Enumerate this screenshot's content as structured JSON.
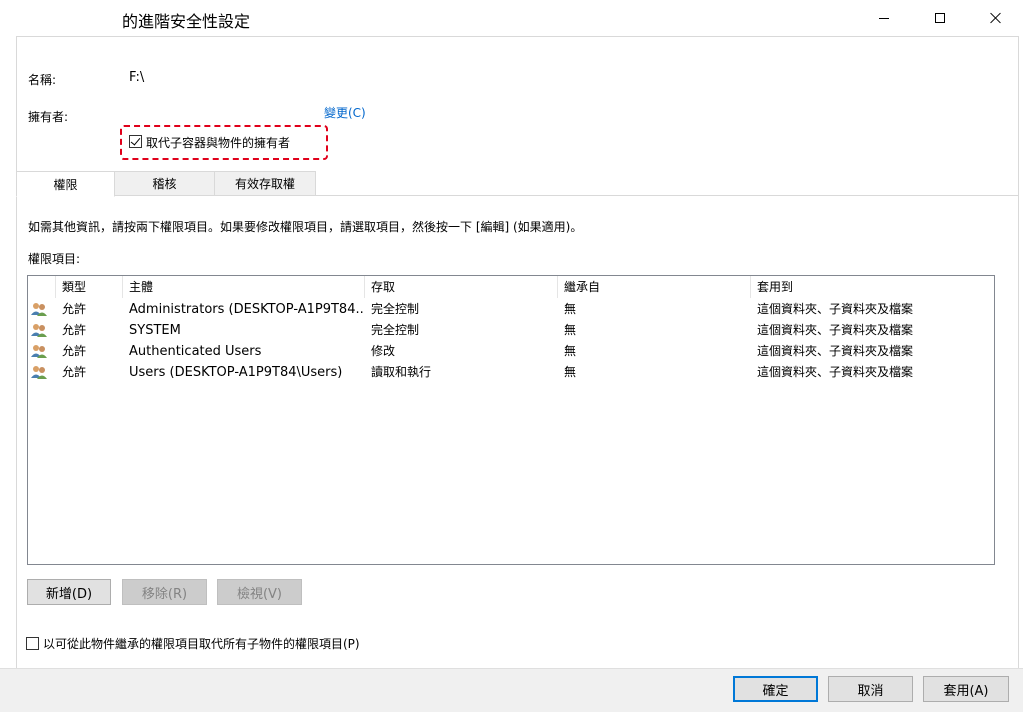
{
  "window": {
    "title": "的進階安全性設定"
  },
  "owner_section": {
    "name_label": "名稱:",
    "name_value": "F:\\",
    "owner_label": "擁有者:",
    "change_link": "變更(C)",
    "replace_owner_label": "取代子容器與物件的擁有者",
    "replace_owner_checked": true
  },
  "tabs": [
    {
      "label": "權限",
      "active": true
    },
    {
      "label": "稽核",
      "active": false
    },
    {
      "label": "有效存取權",
      "active": false
    }
  ],
  "permissions": {
    "instruction": "如需其他資訊，請按兩下權限項目。如果要修改權限項目，請選取項目，然後按一下 [編輯] (如果適用)。",
    "list_label": "權限項目:",
    "columns": [
      "類型",
      "主體",
      "存取",
      "繼承自",
      "套用到"
    ],
    "rows": [
      {
        "type": "允許",
        "principal": "Administrators (DESKTOP-A1P9T84...",
        "access": "完全控制",
        "inherited": "無",
        "applies_to": "這個資料夾、子資料夾及檔案"
      },
      {
        "type": "允許",
        "principal": "SYSTEM",
        "access": "完全控制",
        "inherited": "無",
        "applies_to": "這個資料夾、子資料夾及檔案"
      },
      {
        "type": "允許",
        "principal": "Authenticated Users",
        "access": "修改",
        "inherited": "無",
        "applies_to": "這個資料夾、子資料夾及檔案"
      },
      {
        "type": "允許",
        "principal": "Users (DESKTOP-A1P9T84\\Users)",
        "access": "讀取和執行",
        "inherited": "無",
        "applies_to": "這個資料夾、子資料夾及檔案"
      }
    ],
    "add_button": "新增(D)",
    "remove_button": "移除(R)",
    "view_button": "檢視(V)",
    "replace_child_label": "以可從此物件繼承的權限項目取代所有子物件的權限項目(P)",
    "replace_child_checked": false
  },
  "footer": {
    "ok_button": "確定",
    "cancel_button": "取消",
    "apply_button": "套用(A)"
  },
  "colors": {
    "link": "#0066cc",
    "highlight": "#e0001a",
    "default_button_border": "#0078d7"
  }
}
